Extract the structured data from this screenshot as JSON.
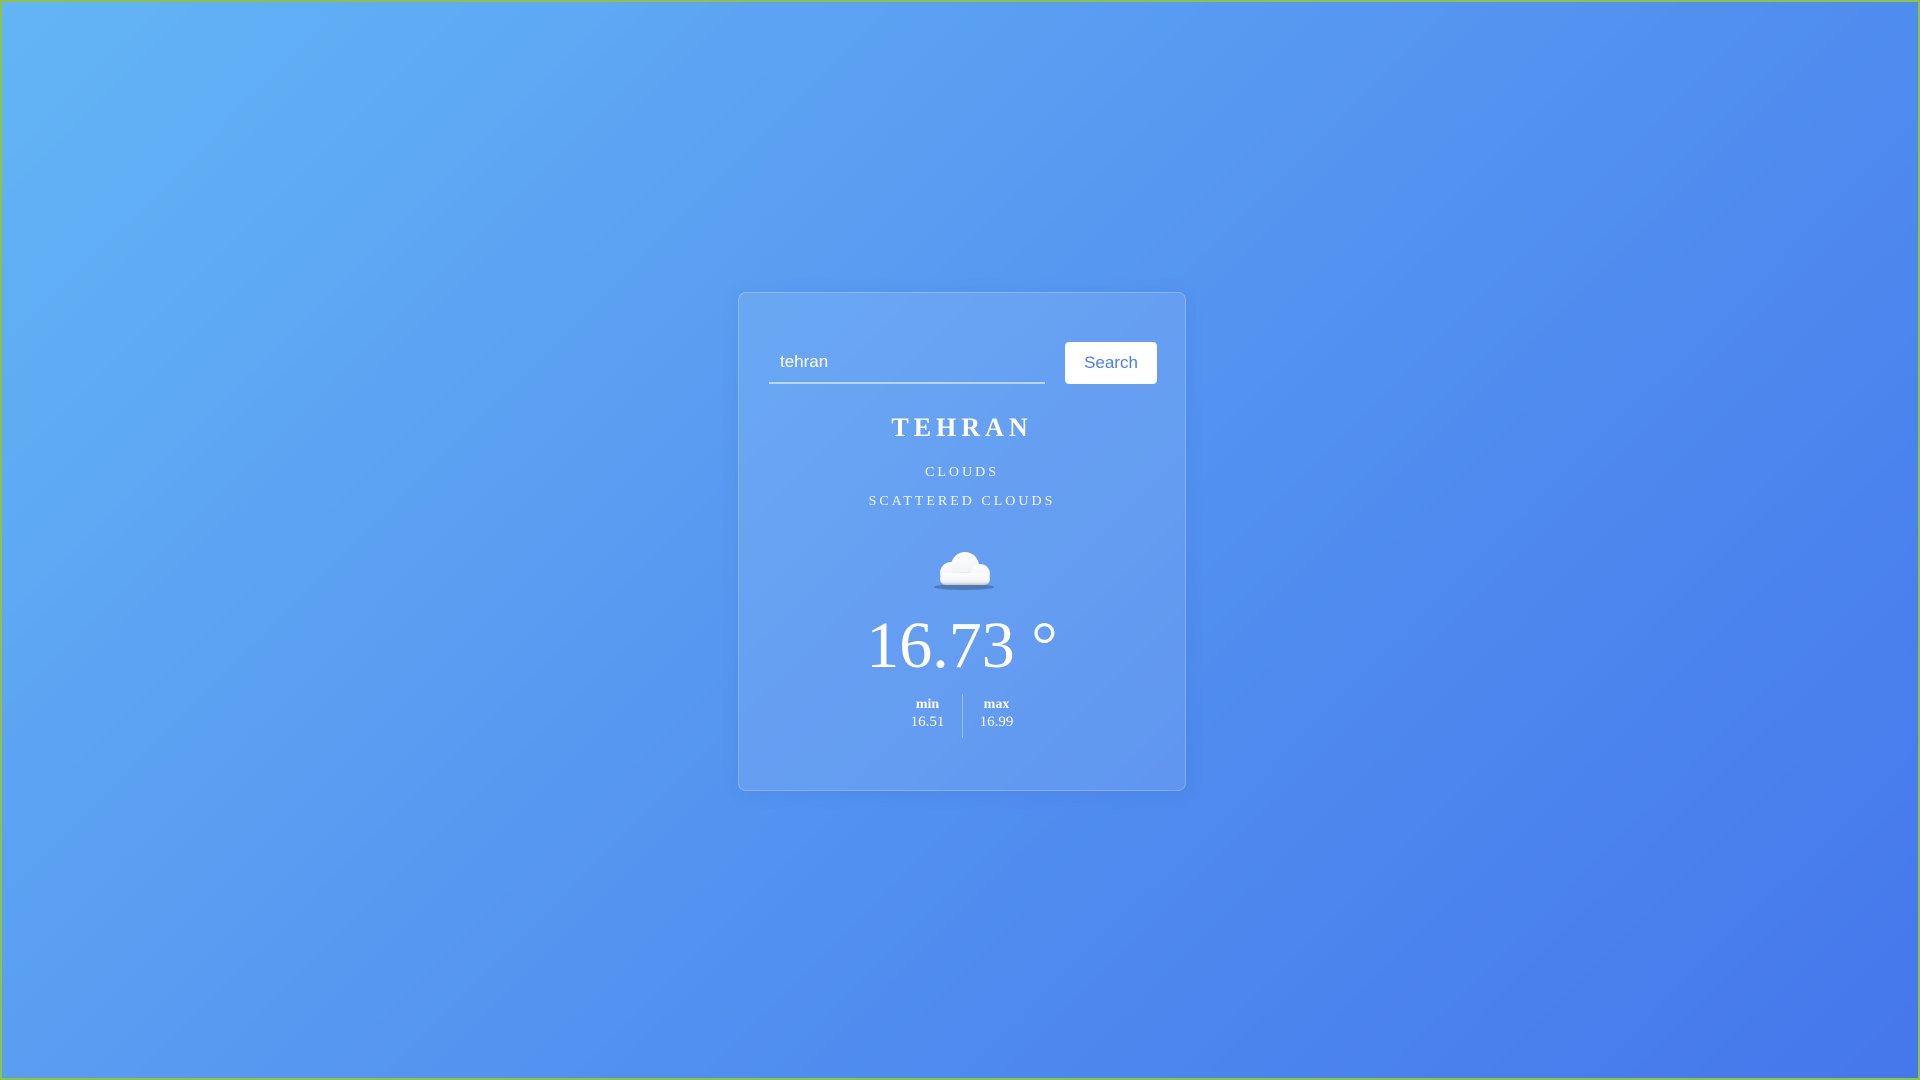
{
  "search": {
    "value": "tehran",
    "button_label": "Search"
  },
  "weather": {
    "city": "TEHRAN",
    "condition": "CLOUDS",
    "description": "SCATTERED CLOUDS",
    "icon": "cloud-icon",
    "temperature": "16.73 °",
    "min_label": "min",
    "min_value": "16.51",
    "max_label": "max",
    "max_value": "16.99"
  },
  "colors": {
    "background_start": "#63b5f6",
    "background_end": "#4577ec",
    "button_text": "#4a7fe4"
  }
}
